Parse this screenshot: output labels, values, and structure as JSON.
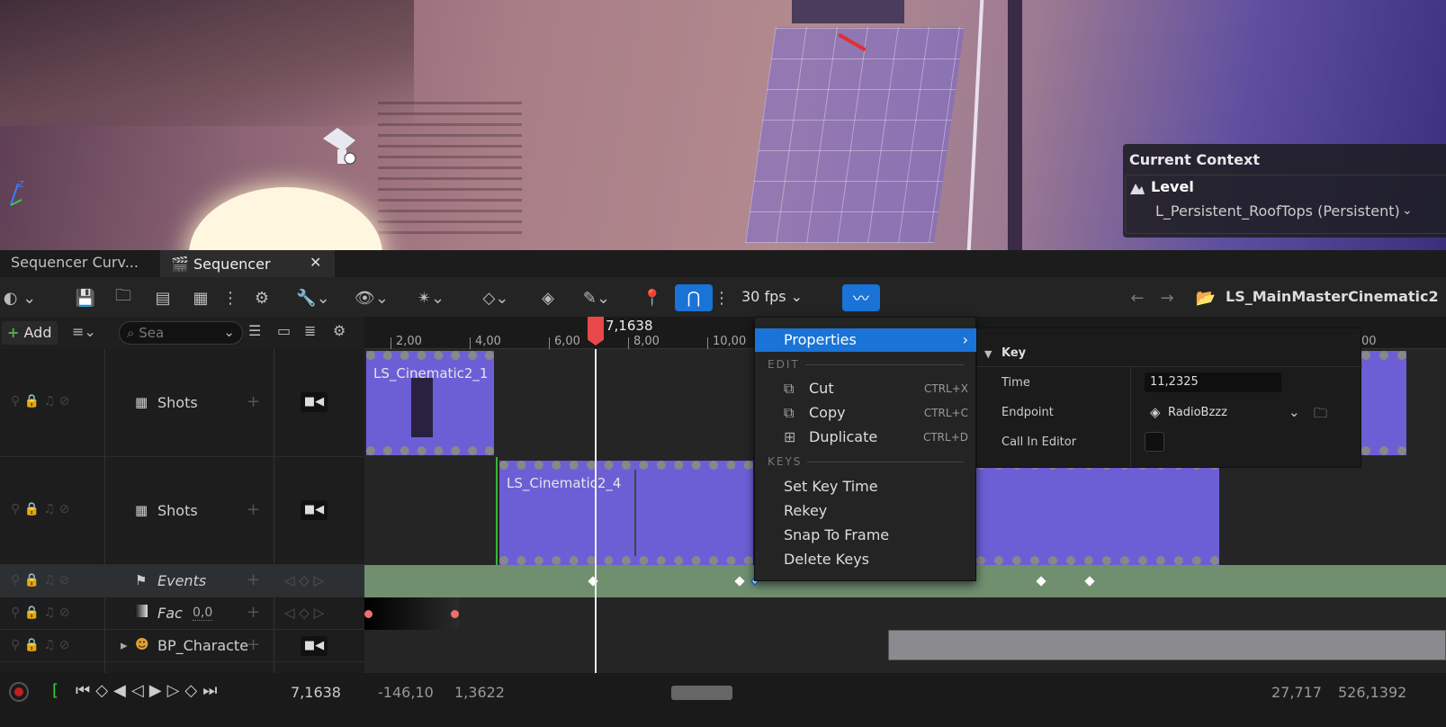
{
  "viewport": {
    "context_title": "Current Context",
    "level_label": "Level",
    "level_value": "L_Persistent_RoofTops (Persistent)"
  },
  "tabs": [
    {
      "label": "Sequencer Curv...",
      "active": false
    },
    {
      "label": "Sequencer",
      "active": true
    }
  ],
  "toolbar": {
    "fps": "30 fps",
    "breadcrumb": "LS_MainMasterCinematic2"
  },
  "filter": {
    "add_label": "Add",
    "search_placeholder": "Sea"
  },
  "ruler": {
    "ticks": [
      "2,00",
      "4,00",
      "6,00",
      "8,00",
      "10,00",
      "00"
    ],
    "playhead_time": "7,1638"
  },
  "tracks": [
    {
      "label": "Shots",
      "italic": false
    },
    {
      "label": "Shots",
      "italic": false
    },
    {
      "label": "Events",
      "italic": true
    },
    {
      "label": "Fac",
      "value": "0,0",
      "italic": true
    },
    {
      "label": "BP_Characte",
      "italic": false
    }
  ],
  "clips": {
    "clip1": "LS_Cinematic2_1",
    "clip2": "LS_Cinematic2_4"
  },
  "menu": {
    "properties": "Properties",
    "edit_header": "EDIT",
    "cut": "Cut",
    "cut_shortcut": "CTRL+X",
    "copy": "Copy",
    "copy_shortcut": "CTRL+C",
    "duplicate": "Duplicate",
    "duplicate_shortcut": "CTRL+D",
    "keys_header": "KEYS",
    "set_key_time": "Set Key Time",
    "rekey": "Rekey",
    "snap_to_frame": "Snap To Frame",
    "delete_keys": "Delete Keys"
  },
  "properties_panel": {
    "header": "Key",
    "time_label": "Time",
    "time_value": "11,2325",
    "endpoint_label": "Endpoint",
    "endpoint_value": "RadioBzzz",
    "call_in_editor_label": "Call In Editor"
  },
  "bottom": {
    "current_time": "7,1638",
    "range_start": "-146,10",
    "range_end": "1,3622",
    "view_start": "27,717",
    "view_end": "526,1392"
  },
  "colors": {
    "accent_blue": "#1a73d6",
    "playhead_red": "#e84848",
    "events_green": "#6f8f6f",
    "clip_purple": "#6c5fd6"
  }
}
